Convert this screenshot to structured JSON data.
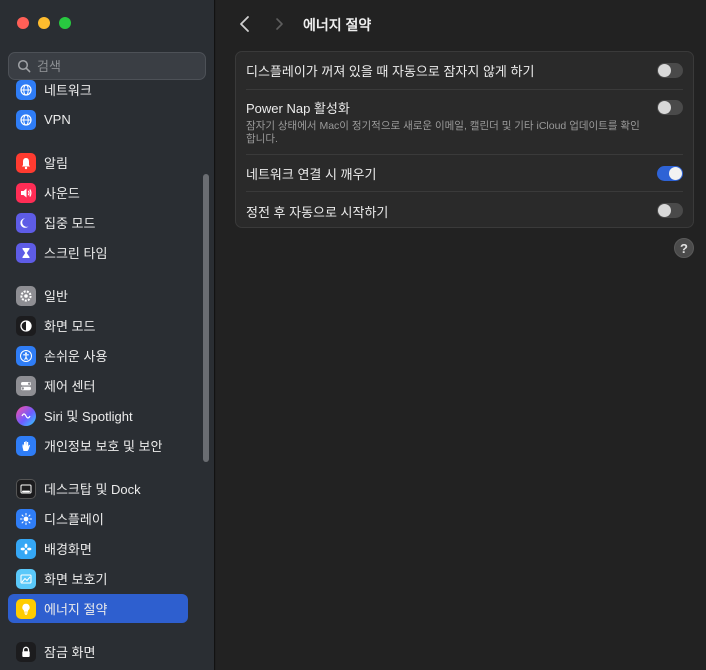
{
  "window": {
    "title": "에너지 절약"
  },
  "search": {
    "placeholder": "검색"
  },
  "sidebar": {
    "items": [
      {
        "label": "네트워크",
        "icon": "globe-icon",
        "color": "#2f7df6"
      },
      {
        "label": "VPN",
        "icon": "globe-icon",
        "color": "#2f7df6"
      },
      {
        "label": "알림",
        "icon": "bell-icon",
        "color": "#ff3b30"
      },
      {
        "label": "사운드",
        "icon": "speaker-icon",
        "color": "#ff2d55"
      },
      {
        "label": "집중 모드",
        "icon": "moon-icon",
        "color": "#5e5ce6"
      },
      {
        "label": "스크린 타임",
        "icon": "hourglass-icon",
        "color": "#5e5ce6"
      },
      {
        "label": "일반",
        "icon": "gear-icon",
        "color": "#8e8e93"
      },
      {
        "label": "화면 모드",
        "icon": "appearance-icon",
        "color": "#1c1c1e"
      },
      {
        "label": "손쉬운 사용",
        "icon": "accessibility-icon",
        "color": "#2f7df6"
      },
      {
        "label": "제어 센터",
        "icon": "switches-icon",
        "color": "#8e8e93"
      },
      {
        "label": "Siri 및 Spotlight",
        "icon": "siri-icon",
        "color": "#b340ff"
      },
      {
        "label": "개인정보 보호 및 보안",
        "icon": "hand-icon",
        "color": "#2f7df6"
      },
      {
        "label": "데스크탑 및 Dock",
        "icon": "dock-icon",
        "color": "#1c1c1e"
      },
      {
        "label": "디스플레이",
        "icon": "sun-icon",
        "color": "#2f7df6"
      },
      {
        "label": "배경화면",
        "icon": "flower-icon",
        "color": "#35a7f5"
      },
      {
        "label": "화면 보호기",
        "icon": "screensaver-icon",
        "color": "#5ac8fa"
      },
      {
        "label": "에너지 절약",
        "icon": "bulb-icon",
        "color": "#ffcc00"
      },
      {
        "label": "잠금 화면",
        "icon": "lock-icon",
        "color": "#1c1c1e"
      }
    ]
  },
  "settings": {
    "rows": [
      {
        "title": "디스플레이가 꺼져 있을 때 자동으로 잠자지 않게 하기",
        "subtitle": "",
        "enabled": false
      },
      {
        "title": "Power Nap 활성화",
        "subtitle": "잠자기 상태에서 Mac이 정기적으로 새로운 이메일, 캘린더 및 기타 iCloud 업데이트를 확인합니다.",
        "enabled": false
      },
      {
        "title": "네트워크 연결 시 깨우기",
        "subtitle": "",
        "enabled": true
      },
      {
        "title": "정전 후 자동으로 시작하기",
        "subtitle": "",
        "enabled": false
      }
    ]
  },
  "help": {
    "label": "?"
  },
  "colors": {
    "accent": "#2e63d6",
    "selection": "#2e5fcf"
  }
}
